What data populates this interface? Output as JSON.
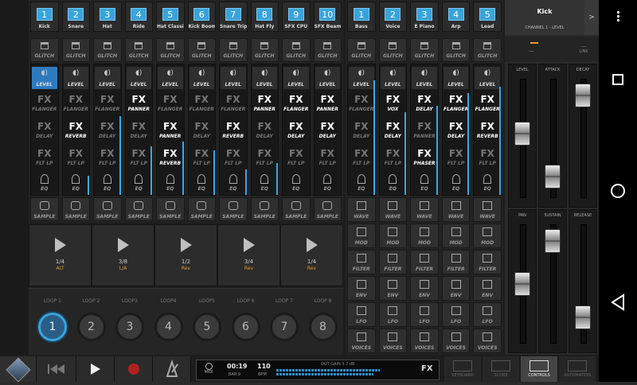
{
  "left_channels": [
    {
      "num": "1",
      "name": "Kick",
      "fx": [
        {
          "label": "FLANGER",
          "on": false
        },
        {
          "label": "DELAY",
          "on": false
        },
        {
          "label": "FLT LP",
          "on": false
        }
      ],
      "selected": true,
      "meter": 0
    },
    {
      "num": "2",
      "name": "Snare",
      "fx": [
        {
          "label": "FLANGER",
          "on": false
        },
        {
          "label": "REVERB",
          "on": true
        },
        {
          "label": "FLT LP",
          "on": false
        }
      ],
      "selected": false,
      "meter": 0.15
    },
    {
      "num": "3",
      "name": "Hat",
      "fx": [
        {
          "label": "FLANGER",
          "on": false
        },
        {
          "label": "DELAY",
          "on": false
        },
        {
          "label": "FLT LP",
          "on": false
        }
      ],
      "selected": false,
      "meter": 0.62
    },
    {
      "num": "4",
      "name": "Ride",
      "fx": [
        {
          "label": "PANNER",
          "on": true
        },
        {
          "label": "DELAY",
          "on": false
        },
        {
          "label": "FLT LP",
          "on": false
        }
      ],
      "selected": false,
      "meter": 0.38
    },
    {
      "num": "5",
      "name": "Hat Classic",
      "fx": [
        {
          "label": "FLANGER",
          "on": false
        },
        {
          "label": "PANNER",
          "on": true
        },
        {
          "label": "REVERB",
          "on": true
        }
      ],
      "selected": false,
      "meter": 0.42
    },
    {
      "num": "6",
      "name": "Kick Boom",
      "fx": [
        {
          "label": "FLANGER",
          "on": false
        },
        {
          "label": "DELAY",
          "on": false
        },
        {
          "label": "FLT LP",
          "on": false
        }
      ],
      "selected": false,
      "meter": 0.35
    },
    {
      "num": "7",
      "name": "Snare Trip ...",
      "fx": [
        {
          "label": "FLANGER",
          "on": false
        },
        {
          "label": "REVERB",
          "on": true
        },
        {
          "label": "FLT LP",
          "on": false
        }
      ],
      "selected": false,
      "meter": 0.2
    },
    {
      "num": "8",
      "name": "Hat Fly",
      "fx": [
        {
          "label": "PANNER",
          "on": true
        },
        {
          "label": "DELAY",
          "on": false
        },
        {
          "label": "FLT LP",
          "on": false
        }
      ],
      "selected": false,
      "meter": 0.25
    },
    {
      "num": "9",
      "name": "SFX CPU",
      "fx": [
        {
          "label": "FLANGER",
          "on": true
        },
        {
          "label": "DELAY",
          "on": true
        },
        {
          "label": "FLT LP",
          "on": false
        }
      ],
      "selected": false,
      "meter": 0
    },
    {
      "num": "10",
      "name": "SFX Beamup",
      "fx": [
        {
          "label": "PANNER",
          "on": true
        },
        {
          "label": "DELAY",
          "on": true
        },
        {
          "label": "FLT LP",
          "on": false
        }
      ],
      "selected": false,
      "meter": 0
    }
  ],
  "right_channels": [
    {
      "num": "1",
      "name": "Bass",
      "fx": [
        {
          "label": "FLANGER",
          "on": false
        },
        {
          "label": "DELAY",
          "on": false
        },
        {
          "label": "FLT LP",
          "on": false
        }
      ],
      "meter": 0.9
    },
    {
      "num": "2",
      "name": "Voice",
      "fx": [
        {
          "label": "VOX",
          "on": true
        },
        {
          "label": "DELAY",
          "on": true
        },
        {
          "label": "FLT LP",
          "on": false
        }
      ],
      "meter": 0.65
    },
    {
      "num": "3",
      "name": "E Piano",
      "fx": [
        {
          "label": "DELAY",
          "on": true
        },
        {
          "label": "PANNER",
          "on": false
        },
        {
          "label": "PHASER",
          "on": true
        }
      ],
      "meter": 0.7
    },
    {
      "num": "4",
      "name": "Arp",
      "fx": [
        {
          "label": "FLANGER",
          "on": true
        },
        {
          "label": "DELAY",
          "on": true
        },
        {
          "label": "FLT LP",
          "on": false
        }
      ],
      "meter": 0.8
    },
    {
      "num": "5",
      "name": "Lead",
      "fx": [
        {
          "label": "FLANGER",
          "on": true
        },
        {
          "label": "REVERB",
          "on": true
        },
        {
          "label": "FLT LP",
          "on": false
        }
      ],
      "meter": 0.85
    }
  ],
  "labels": {
    "glitch": "GLITCH",
    "level": "LEVEL",
    "eq": "EQ",
    "sample": "SAMPLE",
    "wave": "WAVE",
    "mod": "MOD",
    "filter": "FILTER",
    "env": "ENV",
    "lfo": "LFO",
    "voices": "VOICES",
    "fx": "FX",
    "fx_levels": [
      "—",
      "—",
      "—"
    ]
  },
  "sequencers": [
    {
      "division": "1/4",
      "mode": "ALT"
    },
    {
      "division": "3/8",
      "mode": "L/A"
    },
    {
      "division": "1/2",
      "mode": "Rev"
    },
    {
      "division": "3/4",
      "mode": "Rev"
    },
    {
      "division": "1/4",
      "mode": "Rev"
    }
  ],
  "loops": [
    {
      "label": "LOOP 1",
      "num": "1",
      "active": true
    },
    {
      "label": "LOOP 2",
      "num": "2",
      "active": false
    },
    {
      "label": "LOOP3",
      "num": "3",
      "active": false
    },
    {
      "label": "LOOP4",
      "num": "4",
      "active": false
    },
    {
      "label": "LOOP5",
      "num": "5",
      "active": false
    },
    {
      "label": "LOOP 6",
      "num": "6",
      "active": false
    },
    {
      "label": "LOOP 7",
      "num": "7",
      "active": false
    },
    {
      "label": "LOOP 8",
      "num": "8",
      "active": false
    }
  ],
  "inspector": {
    "title": "Kick",
    "subtitle": "CHANNEL 1 - LEVEL",
    "arrow": ">",
    "link": "LINK",
    "level_value": "—",
    "knobs": [
      {
        "label": "LEVEL",
        "value": 0.55
      },
      {
        "label": "ATTACK",
        "value": 0.1
      },
      {
        "label": "DECAY",
        "value": 0.95
      },
      {
        "label": "PAN",
        "value": 0.5
      },
      {
        "label": "SUSTAIN",
        "value": 0.95
      },
      {
        "label": "RELEASE",
        "value": 0.15
      }
    ]
  },
  "transport": {
    "midi": "MIDI",
    "time": "00:19",
    "bar": "BAR 9",
    "bpm": "110",
    "bpm_label": "BPM",
    "out_gain": "OUT GAIN 3.7 dB",
    "fx": "FX"
  },
  "tabs": [
    {
      "label": "KEYBOARD",
      "active": false
    },
    {
      "label": "SCORE",
      "active": false
    },
    {
      "label": "CONTROLS",
      "active": true
    },
    {
      "label": "AUTOMATION",
      "active": false
    }
  ],
  "colors": {
    "accent": "#39a4dc",
    "orange": "#e39b2a",
    "background": "#1d1d1d"
  }
}
